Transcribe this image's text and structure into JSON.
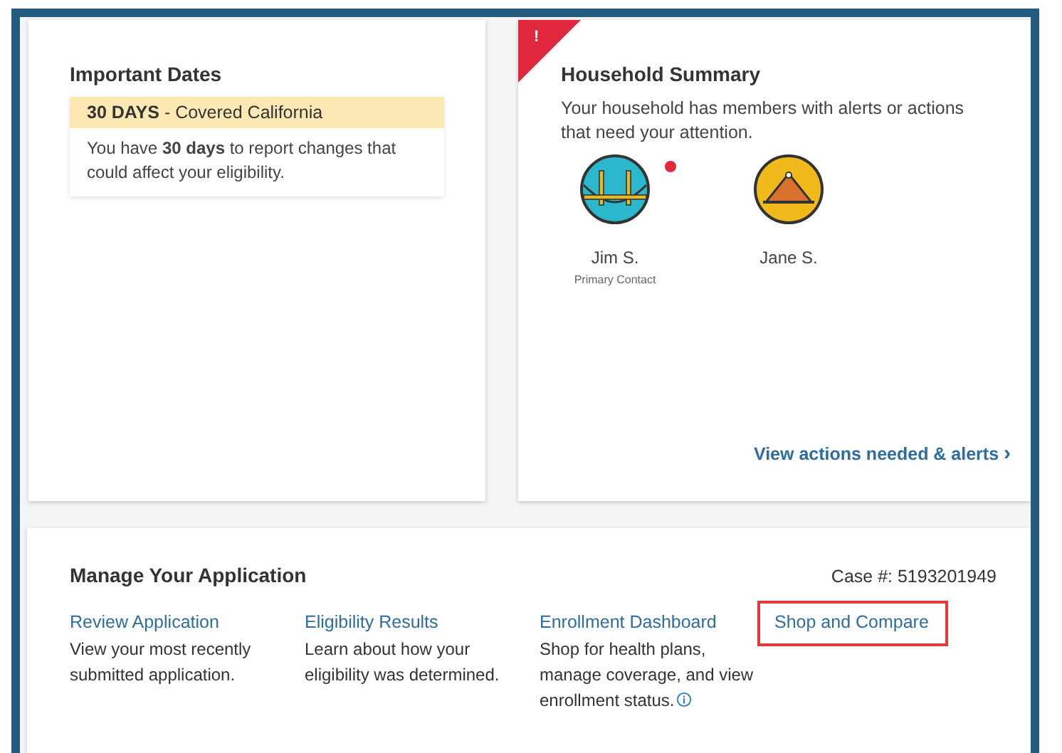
{
  "important_dates": {
    "title": "Important Dates",
    "notice": {
      "heading": "**30 DAYS** - Covered California",
      "body": "You have **30 days** to report changes that could affect your eligibility."
    }
  },
  "household_summary": {
    "alert_flag": "!",
    "title": "Household Summary",
    "message": "Your household has members with alerts or actions that need your attention.",
    "members": [
      {
        "name": "Jim S.",
        "role": "Primary Contact",
        "kind": "bridge",
        "alert": true
      },
      {
        "name": "Jane S.",
        "kind": "mountain",
        "alert": false
      }
    ],
    "link": "View actions needed & alerts",
    "link_icon": "›"
  },
  "manage_application": {
    "title": "Manage Your Application",
    "case_number": "Case #: 5193201949",
    "actions": [
      {
        "label": "Review Application",
        "description": "View your most recently submitted application.",
        "info": false,
        "highlighted": false
      },
      {
        "label": "Eligibility Results",
        "description": "Learn about how your eligibility was determined.",
        "info": false,
        "highlighted": false
      },
      {
        "label": "Enrollment Dashboard",
        "description": "Shop for health plans, manage coverage, and view enrollment status.",
        "info": true,
        "highlighted": false
      },
      {
        "label": "Shop and Compare",
        "highlighted": true
      }
    ]
  }
}
